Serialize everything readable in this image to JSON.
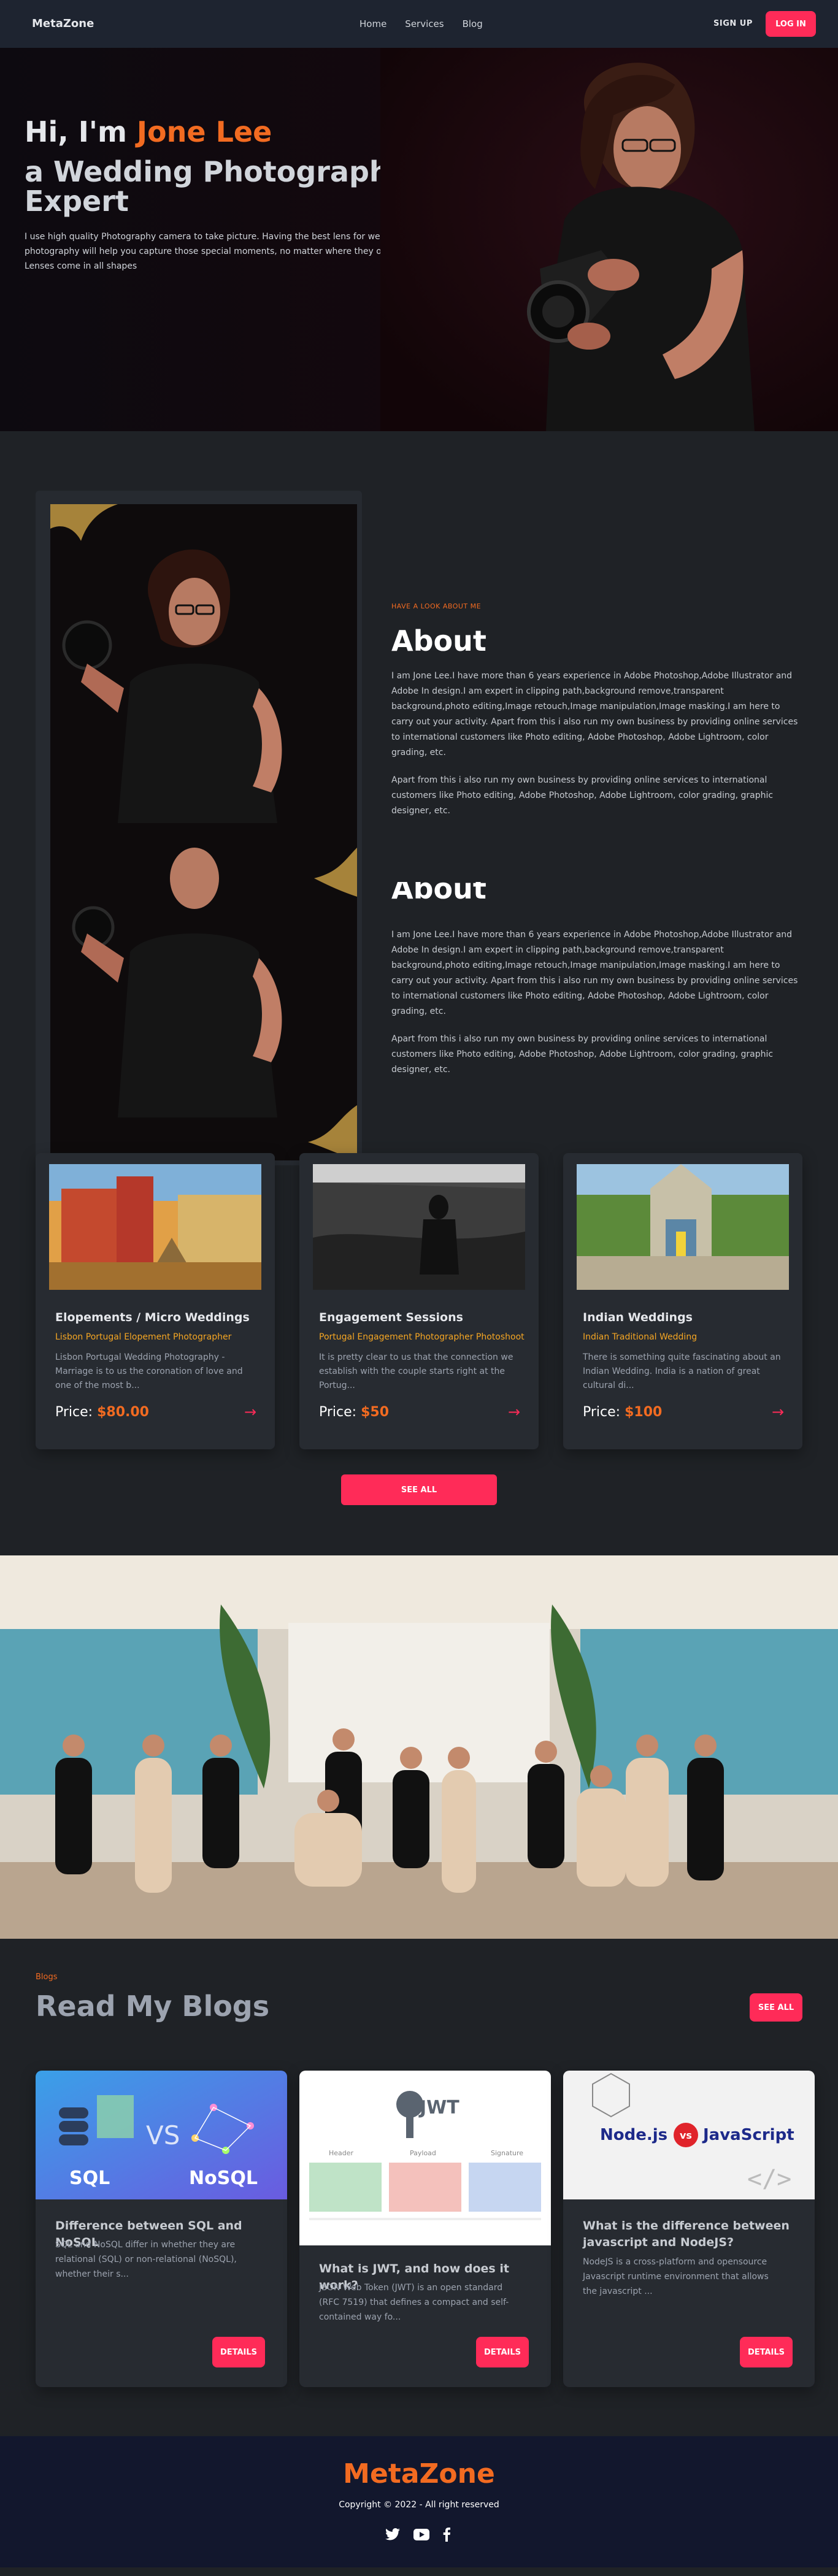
{
  "nav": {
    "brand": "MetaZone",
    "links": [
      "Home",
      "Services",
      "Blog"
    ],
    "signup": "SIGN UP",
    "login": "LOG IN"
  },
  "hero": {
    "greeting": "Hi, I'm ",
    "name": "Jone Lee",
    "headline": "a Wedding Photography Expert",
    "description": "I use high quality Photography camera to take picture. Having the best lens for wedding photography will help you capture those special moments, no matter where they occur. Lenses come in all shapes"
  },
  "about": {
    "kicker": "HAVE A LOOK ABOUT ME",
    "title": "About",
    "para1": "I am Jone Lee.I have more than 6 years experience in Adobe Photoshop,Adobe Illustrator and Adobe In design.I am expert in clipping path,background remove,transparent background,photo editing,Image retouch,Image manipulation,Image masking.I am here to carry out your activity. Apart from this i also run my own business by providing online services to international customers like Photo editing, Adobe Photoshop, Adobe Lightroom, color grading, etc.",
    "para2": "Apart from this i also run my own business by providing online services to international customers like Photo editing, Adobe Photoshop, Adobe Lightroom, color grading, graphic designer, etc."
  },
  "services": [
    {
      "title": "Elopements / Micro Weddings",
      "subtitle": "Lisbon Portugal Elopement Photographer",
      "desc": "Lisbon Portugal Wedding Photography - Marriage is to us the coronation of love and one of the most b...",
      "price_label": "Price: ",
      "price": "$80.00"
    },
    {
      "title": "Engagement Sessions",
      "subtitle": "Portugal Engagement Photographer Photoshoot",
      "desc": "It is pretty clear to us that the connection we establish with the couple starts right at the Portug...",
      "price_label": "Price: ",
      "price": "$50"
    },
    {
      "title": "Indian Weddings",
      "subtitle": "Indian Traditional Wedding",
      "desc": "There is something quite fascinating about an Indian Wedding. India is a nation of great cultural di...",
      "price_label": "Price: ",
      "price": "$100"
    }
  ],
  "see_all": "SEE ALL",
  "blogs": {
    "kicker": "Blogs",
    "title": "Read My Blogs",
    "see_all": "SEE ALL",
    "items": [
      {
        "title": "Difference between SQL and NoSQL",
        "desc": "SQL and NoSQL differ in whether they are relational (SQL) or non-relational (NoSQL), whether their s...",
        "button": "DETAILS",
        "img_left": "SQL",
        "img_mid": "VS",
        "img_right": "NoSQL"
      },
      {
        "title": "What is JWT, and how does it work?",
        "desc": "JSON Web Token (JWT) is an open standard (RFC 7519) that defines a compact and self-contained way fo...",
        "button": "DETAILS",
        "img_logo": "JWT",
        "img_cols": [
          "Header",
          "Payload",
          "Signature"
        ]
      },
      {
        "title": "What is the difference between javascript and NodeJS?",
        "desc": "NodeJS is a cross-platform and opensource Javascript runtime environment that allows the javascript ...",
        "button": "DETAILS",
        "img_left": "Node.js",
        "img_mid": "vs",
        "img_right": "JavaScript"
      }
    ]
  },
  "footer": {
    "logo": "MetaZone",
    "copyright": "Copyright © 2022 - All right reserved"
  },
  "colors": {
    "accent": "#ff2b58",
    "orange": "#f26b21",
    "gold": "#f5a623",
    "bg": "#1f2226",
    "card": "#272b31",
    "footer": "#12172d"
  }
}
